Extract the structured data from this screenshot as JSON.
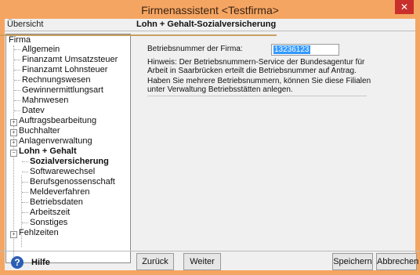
{
  "window": {
    "title": "Firmenassistent <Testfirma>",
    "close_label": "✕"
  },
  "header": {
    "left": "Übersicht",
    "right": "Lohn + Gehalt-Sozialversicherung"
  },
  "tree": [
    {
      "label": "Firma",
      "bold": false
    },
    {
      "label": "Allgemein",
      "bold": false
    },
    {
      "label": "Finanzamt Umsatzsteuer",
      "bold": false
    },
    {
      "label": "Finanzamt Lohnsteuer",
      "bold": false
    },
    {
      "label": "Rechnungswesen",
      "bold": false
    },
    {
      "label": "Gewinnermittlungsart",
      "bold": false
    },
    {
      "label": "Mahnwesen",
      "bold": false
    },
    {
      "label": "Datev",
      "bold": false
    },
    {
      "label": "Auftragsbearbeitung",
      "bold": false
    },
    {
      "label": "Buchhalter",
      "bold": false
    },
    {
      "label": "Anlagenverwaltung",
      "bold": false
    },
    {
      "label": "Lohn + Gehalt",
      "bold": true
    },
    {
      "label": "Sozialversicherung",
      "bold": true
    },
    {
      "label": "Softwarewechsel",
      "bold": false
    },
    {
      "label": "Berufsgenossenschaft",
      "bold": false
    },
    {
      "label": "Meldeverfahren",
      "bold": false
    },
    {
      "label": "Betriebsdaten",
      "bold": false
    },
    {
      "label": "Arbeitszeit",
      "bold": false
    },
    {
      "label": "Sonstiges",
      "bold": false
    },
    {
      "label": "Fehlzeiten",
      "bold": false
    }
  ],
  "form": {
    "field_label": "Betriebsnummer der Firma:",
    "field_value": "13236123",
    "hint1": "Hinweis: Der Betriebsnummern-Service der Bundesagentur für Arbeit in Saarbrücken erteilt die Betriebsnummer auf Antrag.",
    "hint2": "Haben Sie mehrere Betriebsnummern, können Sie diese Filialen unter Verwaltung Betriebsstätten anlegen."
  },
  "footer": {
    "help_label": "Hilfe",
    "help_icon": "?",
    "back_label": "Zurück",
    "next_label": "Weiter",
    "save_label": "Speichern",
    "cancel_label": "Abbrechen"
  },
  "colors": {
    "titlebar": "#f5a562",
    "selection": "#3399ff",
    "close": "#c9302c",
    "callout": "#c8a063"
  }
}
